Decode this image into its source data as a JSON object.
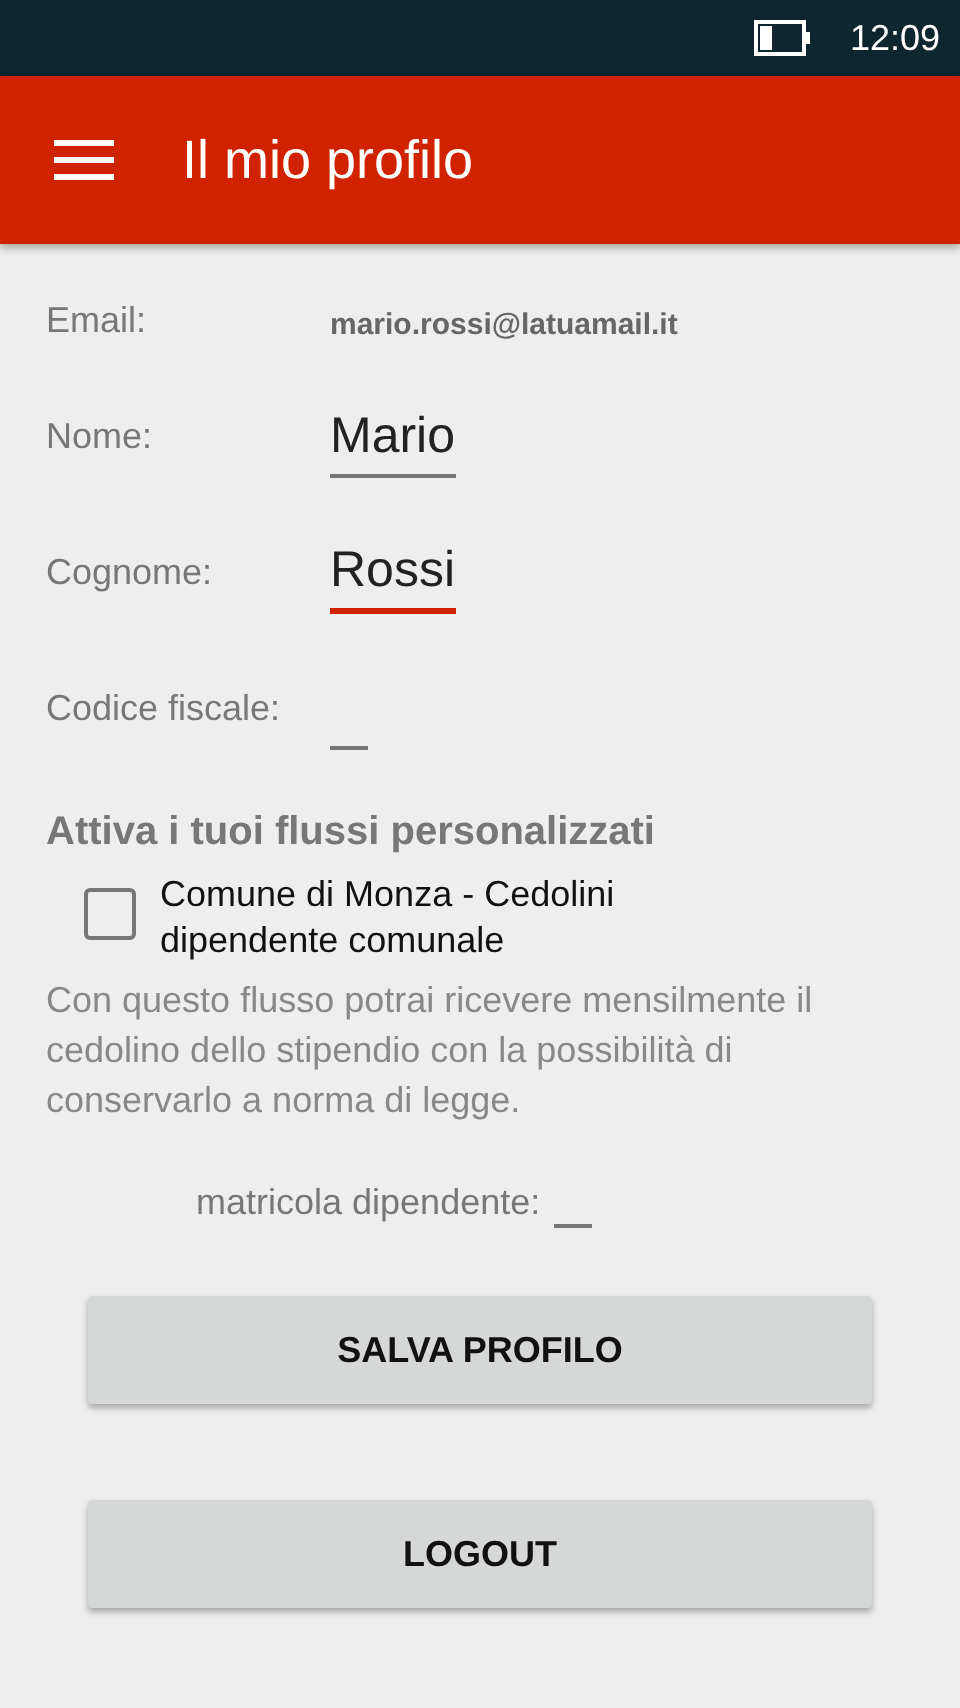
{
  "status_bar": {
    "time": "12:09"
  },
  "app_bar": {
    "title": "Il mio profilo"
  },
  "email": {
    "label": "Email:",
    "value": "mario.rossi@latuamail.it"
  },
  "fields": [
    {
      "label": "Nome:",
      "value": "Mario",
      "focused": false
    },
    {
      "label": "Cognome:",
      "value": "Rossi",
      "focused": true
    },
    {
      "label": "Codice fiscale:",
      "focused": false
    }
  ],
  "flows": {
    "heading": "Attiva i tuoi flussi personalizzati",
    "option": {
      "label": "Comune di Monza - Cedolini dipendente comunale",
      "checked": false
    },
    "description": "Con questo flusso potrai ricevere mensilmente il cedolino dello stipendio con la possibilità di conservarlo a norma di legge.",
    "field": {
      "label": "matricola dipendente:",
      "focused": false
    }
  },
  "buttons": [
    "SALVA PROFILO",
    "LOGOUT"
  ]
}
